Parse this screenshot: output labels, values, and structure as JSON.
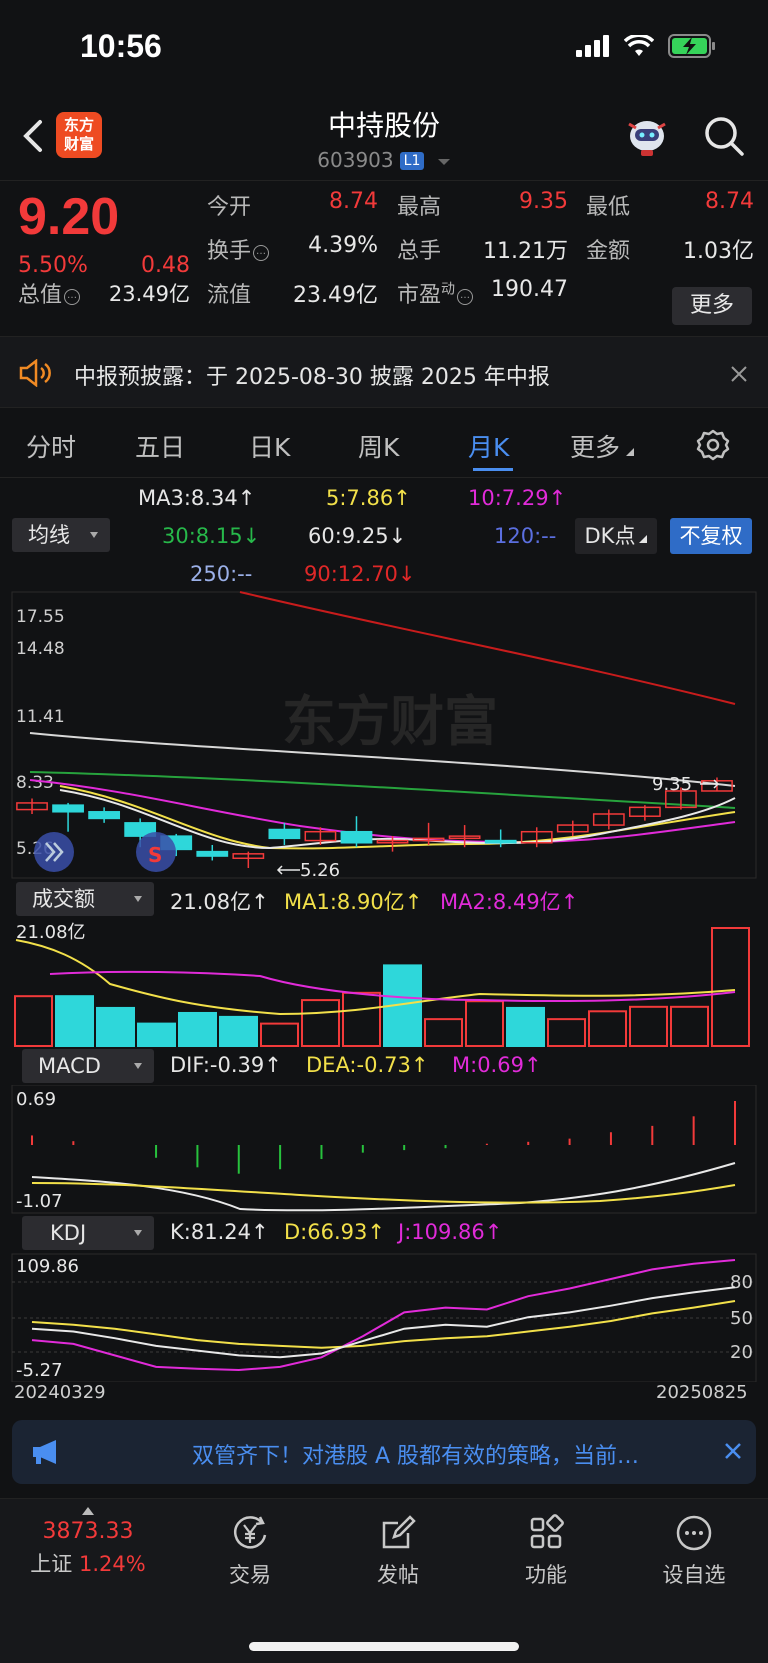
{
  "status": {
    "time": "10:56"
  },
  "header": {
    "logo_line1": "东方",
    "logo_line2": "财富",
    "stock_name": "中持股份",
    "stock_code": "603903",
    "level_badge": "L1"
  },
  "quote": {
    "price": "9.20",
    "change_pct": "5.50%",
    "change_abs": "0.48",
    "open_label": "今开",
    "open": "8.74",
    "high_label": "最高",
    "high": "9.35",
    "low_label": "最低",
    "low": "8.74",
    "turnover_label": "换手",
    "turnover": "4.39%",
    "volume_label": "总手",
    "volume": "11.21万",
    "amount_label": "金额",
    "amount": "1.03亿",
    "total_mv_label": "总值",
    "total_mv": "23.49亿",
    "float_mv_label": "流值",
    "float_mv": "23.49亿",
    "pe_label": "市盈",
    "pe_sup": "动",
    "pe": "190.47",
    "more_label": "更多"
  },
  "notice": {
    "text": "中报预披露：于 2025-08-30 披露 2025 年中报"
  },
  "tabs": [
    {
      "label": "分时"
    },
    {
      "label": "五日"
    },
    {
      "label": "日K"
    },
    {
      "label": "周K"
    },
    {
      "label": "月K"
    },
    {
      "label": "更多"
    }
  ],
  "ma_legend": {
    "selector": "均线",
    "ma3": "MA3:8.34",
    "ma5": "5:7.86",
    "ma10": "10:7.29",
    "ma30": "30:8.15",
    "ma60": "60:9.25",
    "ma120": "120:--",
    "ma250": "250:--",
    "ma90": "90:12.70",
    "dk_label": "DK点",
    "fq_label": "不复权"
  },
  "kline": {
    "y_labels": [
      "17.55",
      "14.48",
      "11.41",
      "8.33",
      "5.26"
    ],
    "high_marker": "9.35",
    "low_marker": "5.26",
    "watermark": "东方财富",
    "s_badge": "S"
  },
  "volume": {
    "selector": "成交额",
    "value": "21.08亿",
    "ma1": "MA1:8.90亿",
    "ma2": "MA2:8.49亿",
    "y_top": "21.08亿"
  },
  "macd": {
    "selector": "MACD",
    "dif": "DIF:-0.39",
    "dea": "DEA:-0.73",
    "m": "M:0.69",
    "y_top": "0.69",
    "y_bottom": "-1.07"
  },
  "kdj": {
    "selector": "KDJ",
    "k": "K:81.24",
    "d": "D:66.93",
    "j": "J:109.86",
    "y_top": "109.86",
    "y_bottom": "-5.27",
    "lv80": "80",
    "lv50": "50",
    "lv20": "20"
  },
  "dates": {
    "start": "20240329",
    "end": "20250825"
  },
  "ad": {
    "text": "双管齐下！对港股 A 股都有效的策略，当前…"
  },
  "bottom_nav": {
    "index_value": "3873.33",
    "index_name": "上证",
    "index_change": "1.24%",
    "trade": "交易",
    "post": "发帖",
    "function": "功能",
    "watchlist": "设自选"
  },
  "colors": {
    "up": "#f23a3a",
    "down": "#2ed7da",
    "accent": "#4a8ef0"
  },
  "chart_data": {
    "type": "candlestick",
    "x_start": "20240329",
    "x_end": "20250825",
    "ylim": [
      5.26,
      17.55
    ],
    "candles": [
      {
        "o": 8.2,
        "h": 8.4,
        "l": 7.7,
        "c": 7.9,
        "up": true
      },
      {
        "o": 8.1,
        "h": 8.2,
        "l": 6.9,
        "c": 7.8,
        "up": false
      },
      {
        "o": 7.8,
        "h": 8.0,
        "l": 7.3,
        "c": 7.5,
        "up": false
      },
      {
        "o": 7.3,
        "h": 7.5,
        "l": 6.2,
        "c": 6.7,
        "up": false
      },
      {
        "o": 6.7,
        "h": 6.8,
        "l": 5.8,
        "c": 6.1,
        "up": false
      },
      {
        "o": 6.0,
        "h": 6.3,
        "l": 5.6,
        "c": 5.8,
        "up": false
      },
      {
        "o": 5.7,
        "h": 6.0,
        "l": 5.26,
        "c": 5.9,
        "up": true
      },
      {
        "o": 7.0,
        "h": 7.3,
        "l": 6.3,
        "c": 6.6,
        "up": false
      },
      {
        "o": 6.5,
        "h": 7.1,
        "l": 6.3,
        "c": 6.9,
        "up": true
      },
      {
        "o": 6.9,
        "h": 7.6,
        "l": 6.2,
        "c": 6.4,
        "up": false
      },
      {
        "o": 6.4,
        "h": 6.7,
        "l": 6.0,
        "c": 6.5,
        "up": true
      },
      {
        "o": 6.5,
        "h": 7.3,
        "l": 6.3,
        "c": 6.6,
        "up": true
      },
      {
        "o": 6.6,
        "h": 7.2,
        "l": 6.2,
        "c": 6.7,
        "up": true
      },
      {
        "o": 6.5,
        "h": 7.0,
        "l": 6.2,
        "c": 6.4,
        "up": false
      },
      {
        "o": 6.4,
        "h": 7.1,
        "l": 6.2,
        "c": 6.9,
        "up": true
      },
      {
        "o": 6.9,
        "h": 7.4,
        "l": 6.7,
        "c": 7.2,
        "up": true
      },
      {
        "o": 7.2,
        "h": 7.9,
        "l": 7.0,
        "c": 7.7,
        "up": true
      },
      {
        "o": 7.6,
        "h": 8.1,
        "l": 7.4,
        "c": 8.0,
        "up": true
      },
      {
        "o": 8.0,
        "h": 8.9,
        "l": 7.9,
        "c": 8.74,
        "up": true
      },
      {
        "o": 8.74,
        "h": 9.35,
        "l": 8.74,
        "c": 9.2,
        "up": true
      }
    ],
    "volume": [
      {
        "v": 8.9,
        "up": true
      },
      {
        "v": 8.9,
        "up": false
      },
      {
        "v": 6.8,
        "up": false
      },
      {
        "v": 4.0,
        "up": false
      },
      {
        "v": 5.9,
        "up": false
      },
      {
        "v": 5.2,
        "up": false
      },
      {
        "v": 4.0,
        "up": true
      },
      {
        "v": 8.2,
        "up": true
      },
      {
        "v": 9.5,
        "up": true
      },
      {
        "v": 14.4,
        "up": false
      },
      {
        "v": 4.8,
        "up": true
      },
      {
        "v": 8.0,
        "up": true
      },
      {
        "v": 6.8,
        "up": false
      },
      {
        "v": 4.8,
        "up": true
      },
      {
        "v": 6.2,
        "up": true
      },
      {
        "v": 7.0,
        "up": true
      },
      {
        "v": 7.0,
        "up": true
      },
      {
        "v": 21.08,
        "up": true
      }
    ],
    "macd_hist": [
      0.15,
      0.06,
      0.0,
      -0.2,
      -0.35,
      -0.45,
      -0.38,
      -0.22,
      -0.12,
      -0.08,
      -0.05,
      0.02,
      0.05,
      0.1,
      0.2,
      0.3,
      0.45,
      0.69
    ],
    "kdj_k": [
      38,
      35,
      28,
      20,
      15,
      10,
      8,
      12,
      25,
      38,
      42,
      40,
      50,
      55,
      62,
      70,
      76,
      81.24
    ],
    "kdj_d": [
      45,
      42,
      38,
      32,
      26,
      22,
      20,
      18,
      20,
      25,
      28,
      30,
      35,
      40,
      46,
      54,
      60,
      66.93
    ],
    "kdj_j": [
      26,
      22,
      10,
      -2,
      -4,
      -5.27,
      -2,
      8,
      30,
      55,
      60,
      58,
      72,
      80,
      90,
      100,
      106,
      109.86
    ]
  }
}
